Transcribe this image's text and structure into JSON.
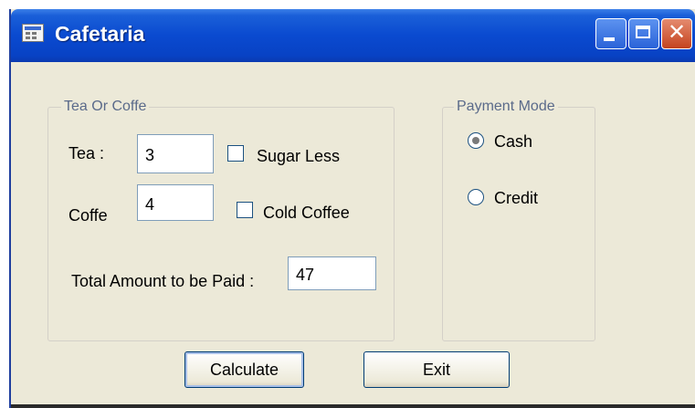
{
  "window": {
    "title": "Cafetaria",
    "controls": {
      "minimize": "minimize",
      "maximize": "maximize",
      "close": "close"
    }
  },
  "order_group": {
    "label": "Tea Or Coffe",
    "tea_label": "Tea :",
    "tea_value": "3",
    "sugar_less_label": "Sugar Less",
    "sugar_less_checked": false,
    "coffe_label": "Coffe",
    "coffe_value": "4",
    "cold_coffee_label": "Cold Coffee",
    "cold_coffee_checked": false,
    "total_label": "Total Amount to be Paid :",
    "total_value": "47"
  },
  "payment_group": {
    "label": "Payment Mode",
    "options": [
      {
        "label": "Cash",
        "selected": true
      },
      {
        "label": "Credit",
        "selected": false
      }
    ]
  },
  "buttons": {
    "calculate": "Calculate",
    "exit": "Exit"
  },
  "icons": {
    "app": "form-window-icon",
    "minimize": "minimize-icon",
    "maximize": "maximize-icon",
    "close": "close-icon"
  },
  "colors": {
    "titlebar": "#0a4ad0",
    "window_bg": "#ece9d8",
    "close_button": "#c4431f"
  }
}
